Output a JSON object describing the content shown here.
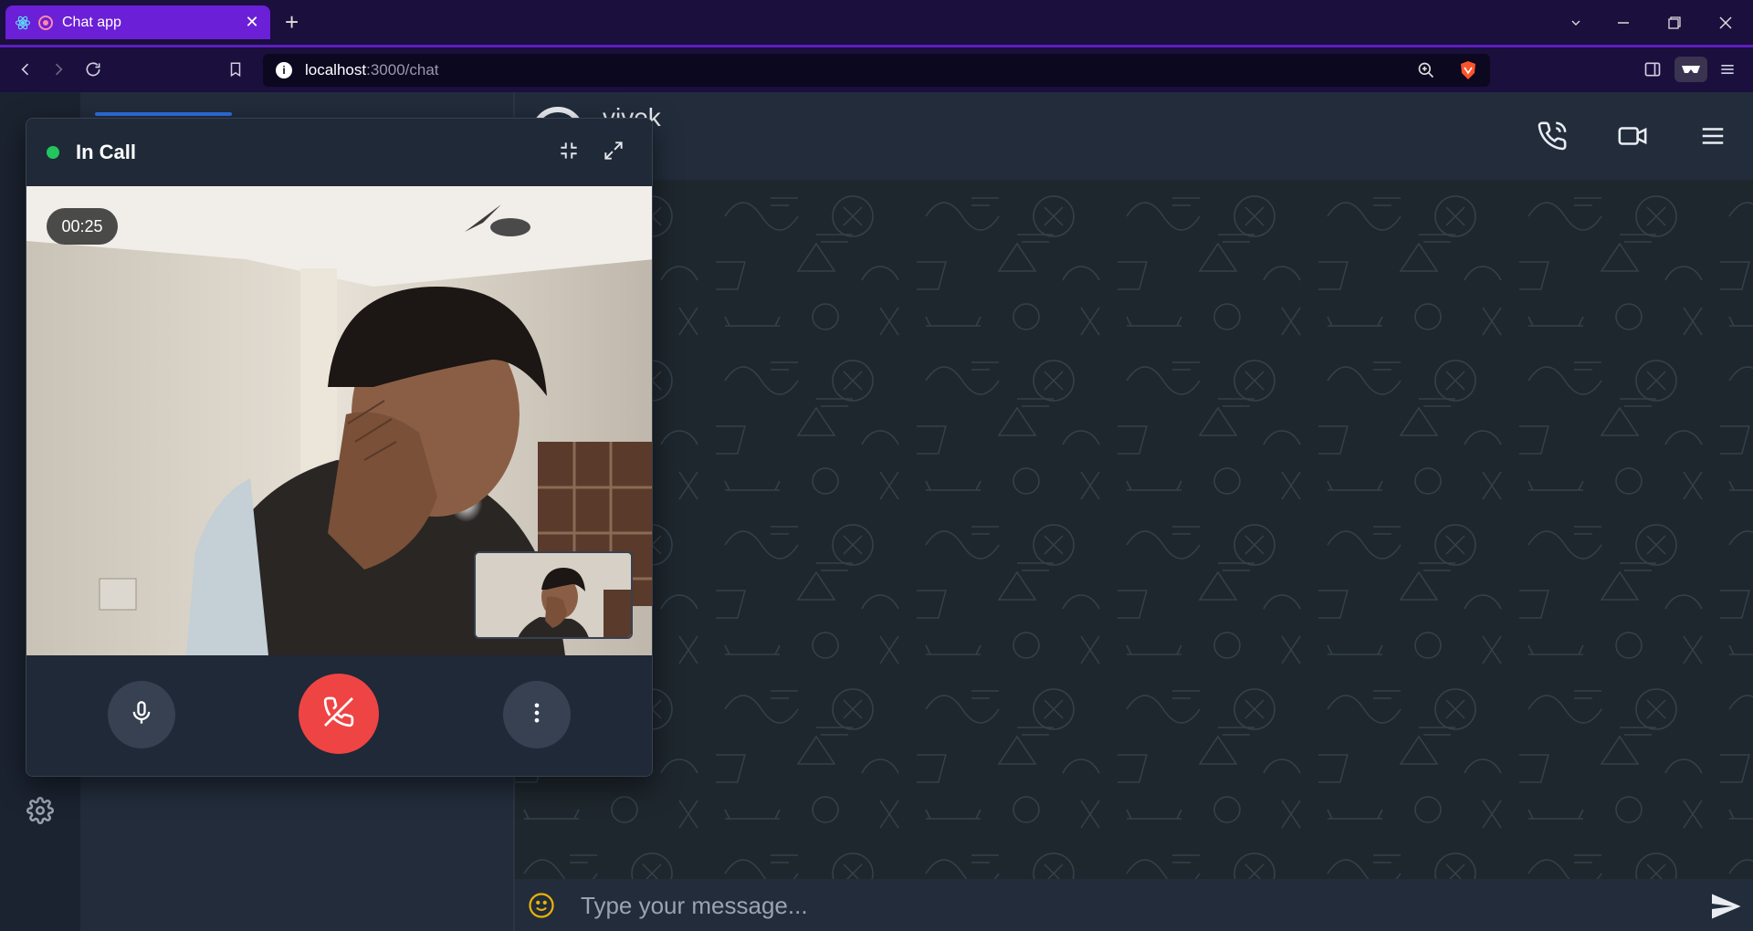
{
  "browser": {
    "tab_title": "Chat app",
    "tab_close": "✕",
    "new_tab": "+",
    "url_host": "localhost",
    "url_path": ":3000/chat"
  },
  "chat": {
    "contact_name": "vivek",
    "input_placeholder": "Type your message..."
  },
  "call": {
    "status": "In Call",
    "timer": "00:25"
  },
  "colors": {
    "accent": "#2f6fde",
    "call_active": "#22c55e",
    "end_call": "#ef4444",
    "browser_tab": "#6b1fd6"
  }
}
